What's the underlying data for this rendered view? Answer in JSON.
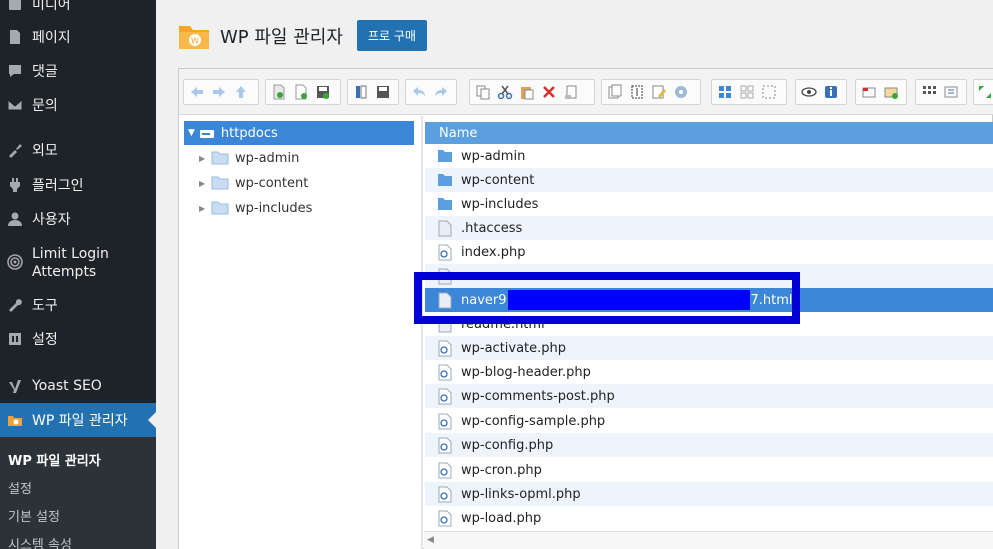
{
  "sidebar": {
    "menu": [
      {
        "label": "미디어",
        "icon": "media-icon"
      },
      {
        "label": "페이지",
        "icon": "page-icon"
      },
      {
        "label": "댓글",
        "icon": "comments-icon"
      },
      {
        "label": "문의",
        "icon": "mail-icon"
      },
      {
        "label": "외모",
        "icon": "appearance-icon"
      },
      {
        "label": "플러그인",
        "icon": "plugins-icon"
      },
      {
        "label": "사용자",
        "icon": "users-icon"
      },
      {
        "label": "Limit Login\nAttempts",
        "icon": "limit-login-icon"
      },
      {
        "label": "도구",
        "icon": "tools-icon"
      },
      {
        "label": "설정",
        "icon": "settings-icon"
      },
      {
        "label": "Yoast SEO",
        "icon": "yoast-icon"
      },
      {
        "label": "WP 파일 관리자",
        "icon": "wp-file-manager-icon"
      }
    ],
    "submenu": [
      "WP 파일 관리자",
      "설정",
      "기본 설정",
      "시스템 속성"
    ]
  },
  "header": {
    "title": "WP 파일 관리자",
    "pro_button": "프로 구매"
  },
  "tree": {
    "root": "httpdocs",
    "children": [
      "wp-admin",
      "wp-content",
      "wp-includes"
    ]
  },
  "list": {
    "column_name": "Name",
    "files": [
      {
        "name": "wp-admin",
        "type": "folder"
      },
      {
        "name": "wp-content",
        "type": "folder"
      },
      {
        "name": "wp-includes",
        "type": "folder"
      },
      {
        "name": ".htaccess",
        "type": "file"
      },
      {
        "name": "index.php",
        "type": "php"
      },
      {
        "name": "",
        "type": "file"
      },
      {
        "name": "naver9",
        "suffix": "7.html",
        "type": "file",
        "selected": true
      },
      {
        "name": "readme.html",
        "type": "file"
      },
      {
        "name": "wp-activate.php",
        "type": "php"
      },
      {
        "name": "wp-blog-header.php",
        "type": "php"
      },
      {
        "name": "wp-comments-post.php",
        "type": "php"
      },
      {
        "name": "wp-config-sample.php",
        "type": "php"
      },
      {
        "name": "wp-config.php",
        "type": "php"
      },
      {
        "name": "wp-cron.php",
        "type": "php"
      },
      {
        "name": "wp-links-opml.php",
        "type": "php"
      },
      {
        "name": "wp-load.php",
        "type": "php"
      }
    ]
  },
  "colors": {
    "sidebar_bg": "#1d2327",
    "accent": "#2271b1",
    "selection": "#3b86d6",
    "list_header": "#5b9fde",
    "highlight": "#0000d6"
  }
}
